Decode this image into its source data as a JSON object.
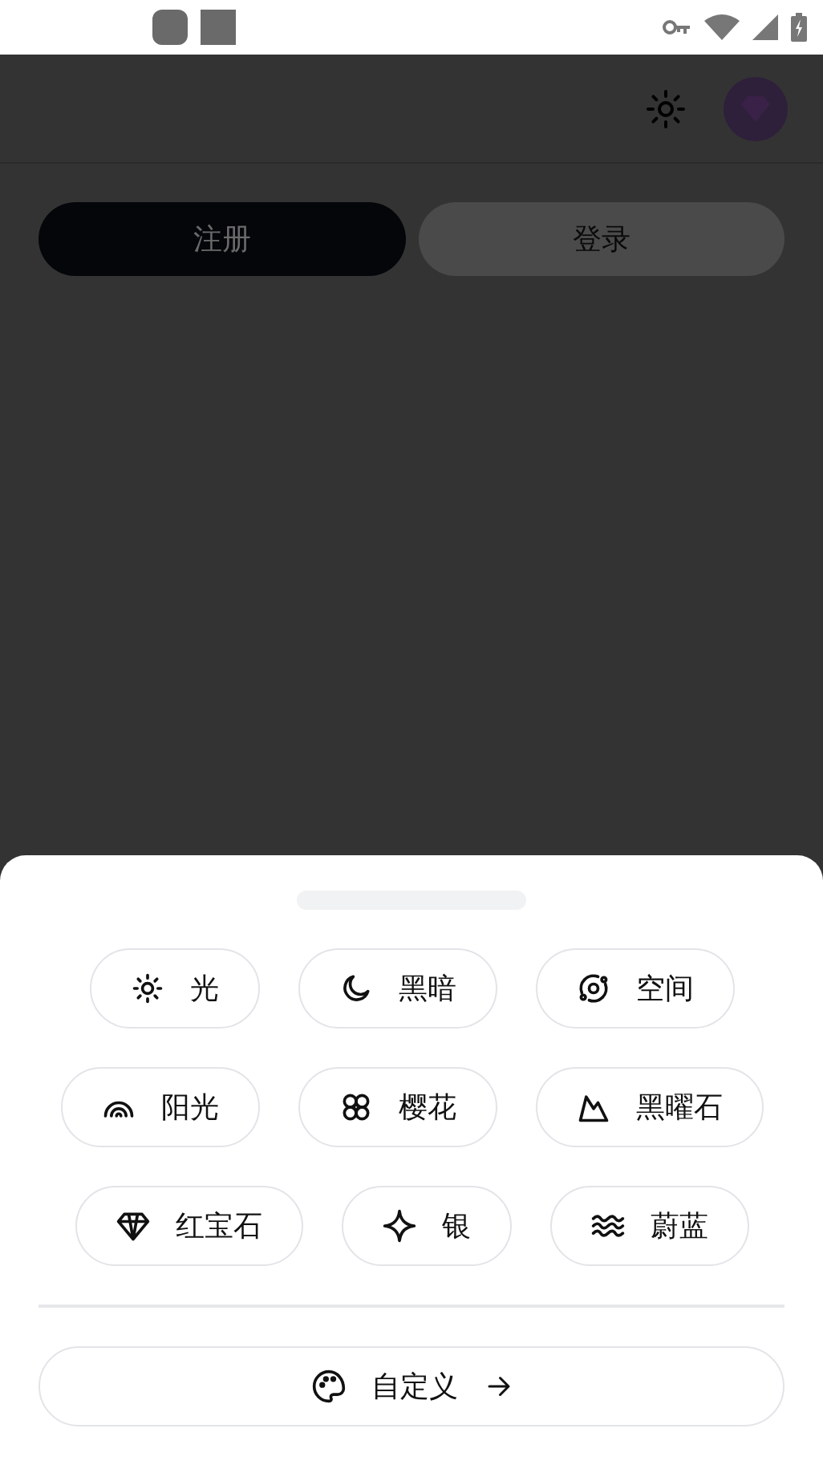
{
  "tabs": [
    {
      "label": "注册",
      "selected": true
    },
    {
      "label": "登录",
      "selected": false
    }
  ],
  "theme_sheet": {
    "rows": [
      [
        {
          "label": "光",
          "kind": "sun"
        },
        {
          "label": "黑暗",
          "kind": "moon"
        },
        {
          "label": "空间",
          "kind": "orbit"
        }
      ],
      [
        {
          "label": "阳光",
          "kind": "rainbow"
        },
        {
          "label": "樱花",
          "kind": "flower"
        },
        {
          "label": "黑曜石",
          "kind": "mountain"
        }
      ],
      [
        {
          "label": "红宝石",
          "kind": "gem"
        },
        {
          "label": "银",
          "kind": "sparkle"
        },
        {
          "label": "蔚蓝",
          "kind": "waves"
        }
      ]
    ],
    "custom_button": {
      "label": "自定义"
    }
  }
}
